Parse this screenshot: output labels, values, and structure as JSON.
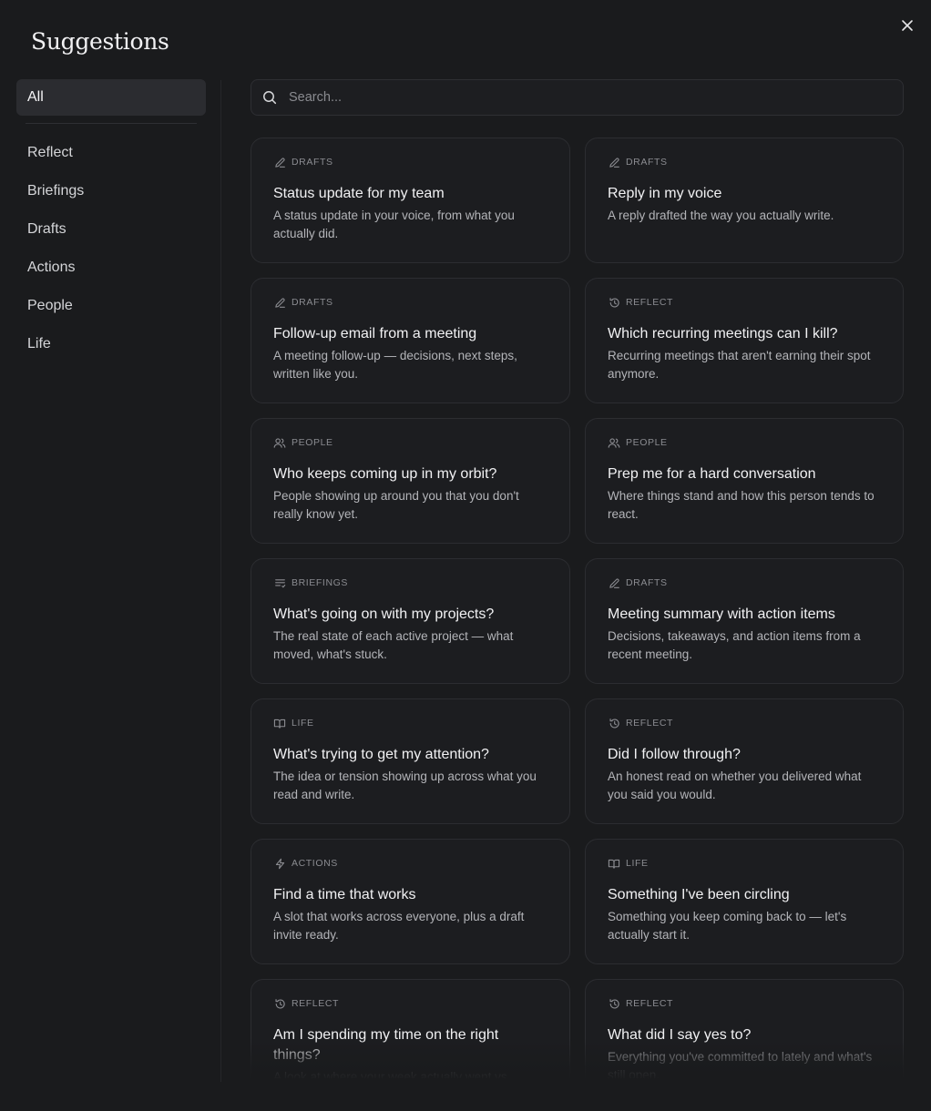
{
  "header": {
    "title": "Suggestions",
    "close_icon": "close-icon"
  },
  "sidebar": {
    "all_label": "All",
    "items": [
      {
        "label": "Reflect"
      },
      {
        "label": "Briefings"
      },
      {
        "label": "Drafts"
      },
      {
        "label": "Actions"
      },
      {
        "label": "People"
      },
      {
        "label": "Life"
      }
    ]
  },
  "search": {
    "placeholder": "Search...",
    "value": "",
    "icon": "search-icon"
  },
  "cards": [
    {
      "category": "DRAFTS",
      "icon": "pencil-icon",
      "title": "Status update for my team",
      "description": "A status update in your voice, from what you actually did."
    },
    {
      "category": "DRAFTS",
      "icon": "pencil-icon",
      "title": "Reply in my voice",
      "description": "A reply drafted the way you actually write."
    },
    {
      "category": "DRAFTS",
      "icon": "pencil-icon",
      "title": "Follow-up email from a meeting",
      "description": "A meeting follow-up — decisions, next steps, written like you."
    },
    {
      "category": "REFLECT",
      "icon": "history-icon",
      "title": "Which recurring meetings can I kill?",
      "description": "Recurring meetings that aren't earning their spot anymore."
    },
    {
      "category": "PEOPLE",
      "icon": "people-icon",
      "title": "Who keeps coming up in my orbit?",
      "description": "People showing up around you that you don't really know yet."
    },
    {
      "category": "PEOPLE",
      "icon": "people-icon",
      "title": "Prep me for a hard conversation",
      "description": "Where things stand and how this person tends to react."
    },
    {
      "category": "BRIEFINGS",
      "icon": "list-icon",
      "title": "What's going on with my projects?",
      "description": "The real state of each active project — what moved, what's stuck."
    },
    {
      "category": "DRAFTS",
      "icon": "pencil-icon",
      "title": "Meeting summary with action items",
      "description": "Decisions, takeaways, and action items from a recent meeting."
    },
    {
      "category": "LIFE",
      "icon": "book-icon",
      "title": "What's trying to get my attention?",
      "description": "The idea or tension showing up across what you read and write."
    },
    {
      "category": "REFLECT",
      "icon": "history-icon",
      "title": "Did I follow through?",
      "description": "An honest read on whether you delivered what you said you would."
    },
    {
      "category": "ACTIONS",
      "icon": "bolt-icon",
      "title": "Find a time that works",
      "description": "A slot that works across everyone, plus a draft invite ready."
    },
    {
      "category": "LIFE",
      "icon": "book-icon",
      "title": "Something I've been circling",
      "description": "Something you keep coming back to — let's actually start it."
    },
    {
      "category": "REFLECT",
      "icon": "history-icon",
      "title": "Am I spending my time on the right things?",
      "description": "A look at where your week actually went vs"
    },
    {
      "category": "REFLECT",
      "icon": "history-icon",
      "title": "What did I say yes to?",
      "description": "Everything you've committed to lately and what's still open."
    }
  ]
}
